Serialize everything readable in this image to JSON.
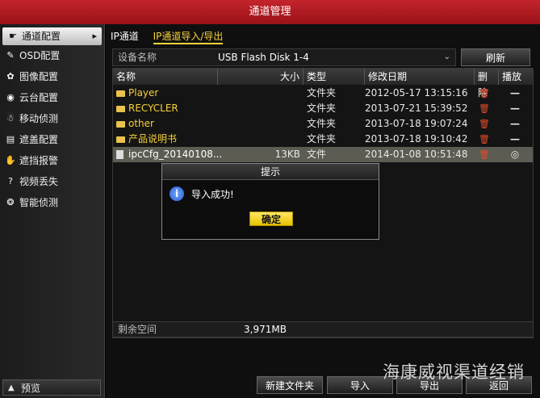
{
  "window": {
    "title": "通道管理"
  },
  "sidebar": {
    "items": [
      {
        "label": "通道配置",
        "icon": "camera-icon",
        "glyph": "☛"
      },
      {
        "label": "OSD配置",
        "icon": "osd-icon",
        "glyph": "✎"
      },
      {
        "label": "图像配置",
        "icon": "image-icon",
        "glyph": "✿"
      },
      {
        "label": "云台配置",
        "icon": "ptz-icon",
        "glyph": "◉"
      },
      {
        "label": "移动侦测",
        "icon": "motion-icon",
        "glyph": "☃"
      },
      {
        "label": "遮盖配置",
        "icon": "mask-icon",
        "glyph": "▤"
      },
      {
        "label": "遮挡报警",
        "icon": "tamper-icon",
        "glyph": "✋"
      },
      {
        "label": "视频丢失",
        "icon": "video-loss-icon",
        "glyph": "?"
      },
      {
        "label": "智能侦测",
        "icon": "smart-detect-icon",
        "glyph": "❂"
      }
    ],
    "preview_label": "预览",
    "preview_glyph": "▲",
    "arrow_glyph": "▸"
  },
  "tabs": [
    {
      "label": "IP通道",
      "active": false
    },
    {
      "label": "IP通道导入/导出",
      "active": true
    }
  ],
  "device": {
    "label": "设备名称",
    "value": "USB Flash Disk 1-4",
    "chevron": "⌄",
    "refresh_label": "刷新"
  },
  "table": {
    "headers": [
      "名称",
      "大小",
      "类型",
      "修改日期",
      "删除",
      "播放"
    ],
    "rows": [
      {
        "name": "Player",
        "size": "",
        "type": "文件夹",
        "date": "2012-05-17 13:15:16",
        "del": "🗑",
        "play": "—",
        "kind": "folder"
      },
      {
        "name": "RECYCLER",
        "size": "",
        "type": "文件夹",
        "date": "2013-07-21 15:39:52",
        "del": "🗑",
        "play": "—",
        "kind": "folder"
      },
      {
        "name": "other",
        "size": "",
        "type": "文件夹",
        "date": "2013-07-18 19:07:24",
        "del": "🗑",
        "play": "—",
        "kind": "folder"
      },
      {
        "name": "产品说明书",
        "size": "",
        "type": "文件夹",
        "date": "2013-07-18 19:10:42",
        "del": "🗑",
        "play": "—",
        "kind": "folder"
      },
      {
        "name": "ipcCfg_20140108...",
        "size": "13KB",
        "type": "文件",
        "date": "2014-01-08 10:51:48",
        "del": "🗑",
        "play": "◎",
        "kind": "file"
      }
    ]
  },
  "free_space": {
    "label": "剩余空间",
    "value": "3,971MB"
  },
  "buttons": {
    "new_folder": "新建文件夹",
    "import": "导入",
    "export": "导出",
    "back": "返回"
  },
  "dialog": {
    "title": "提示",
    "info_glyph": "i",
    "message": "导入成功!",
    "ok_label": "确定"
  },
  "watermark": "海康威视渠道经销"
}
